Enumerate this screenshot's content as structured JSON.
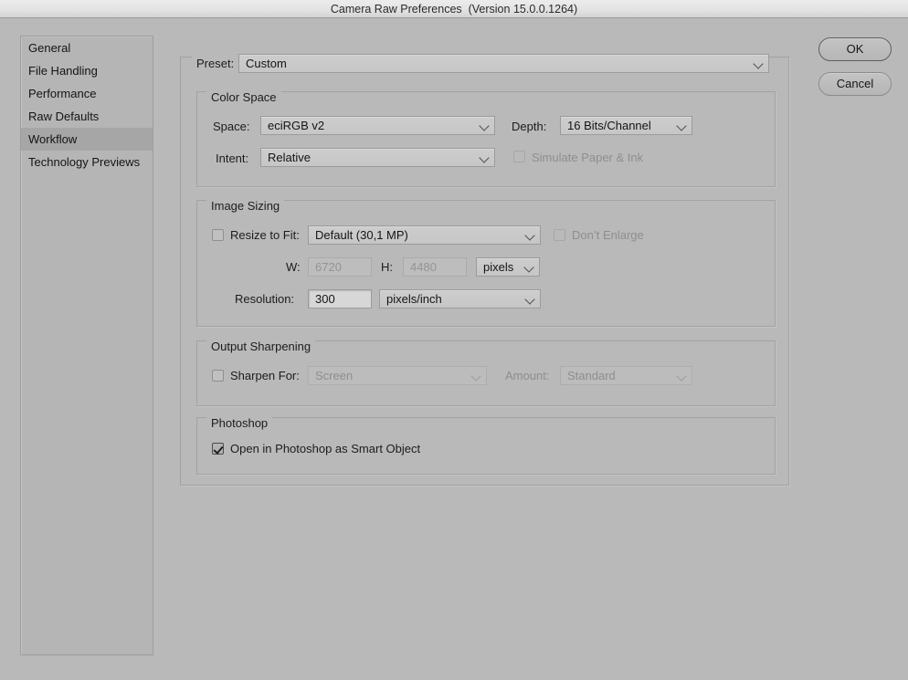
{
  "window": {
    "title": "Camera Raw Preferences  (Version 15.0.0.1264)"
  },
  "sidebar": {
    "items": [
      {
        "label": "General",
        "selected": false
      },
      {
        "label": "File Handling",
        "selected": false
      },
      {
        "label": "Performance",
        "selected": false
      },
      {
        "label": "Raw Defaults",
        "selected": false
      },
      {
        "label": "Workflow",
        "selected": true
      },
      {
        "label": "Technology Previews",
        "selected": false
      }
    ]
  },
  "buttons": {
    "ok": "OK",
    "cancel": "Cancel"
  },
  "preset": {
    "label": "Preset:",
    "value": "Custom"
  },
  "color_space": {
    "legend": "Color Space",
    "space_label": "Space:",
    "space_value": "eciRGB v2",
    "depth_label": "Depth:",
    "depth_value": "16 Bits/Channel",
    "intent_label": "Intent:",
    "intent_value": "Relative",
    "simulate_label": "Simulate Paper & Ink",
    "simulate_checked": false,
    "simulate_enabled": false
  },
  "image_sizing": {
    "legend": "Image Sizing",
    "resize_label": "Resize to Fit:",
    "resize_checked": false,
    "resize_value": "Default  (30,1 MP)",
    "dont_enlarge_label": "Don’t Enlarge",
    "dont_enlarge_checked": false,
    "w_label": "W:",
    "w_value": "6720",
    "h_label": "H:",
    "h_value": "4480",
    "units_value": "pixels",
    "resolution_label": "Resolution:",
    "resolution_value": "300",
    "resolution_units": "pixels/inch"
  },
  "output_sharpening": {
    "legend": "Output Sharpening",
    "sharpen_label": "Sharpen For:",
    "sharpen_checked": false,
    "sharpen_value": "Screen",
    "amount_label": "Amount:",
    "amount_value": "Standard"
  },
  "photoshop": {
    "legend": "Photoshop",
    "smart_object_label": "Open in Photoshop as Smart Object",
    "smart_object_checked": true
  },
  "colors": {
    "window_bg": "#b9b9b9",
    "titlebar_top": "#ececec",
    "titlebar_bottom": "#d4d4d4",
    "selection": "#a6a6a6",
    "border": "#a2a2a2",
    "text": "#1c1c1c",
    "text_disabled": "#8e8e8e"
  }
}
